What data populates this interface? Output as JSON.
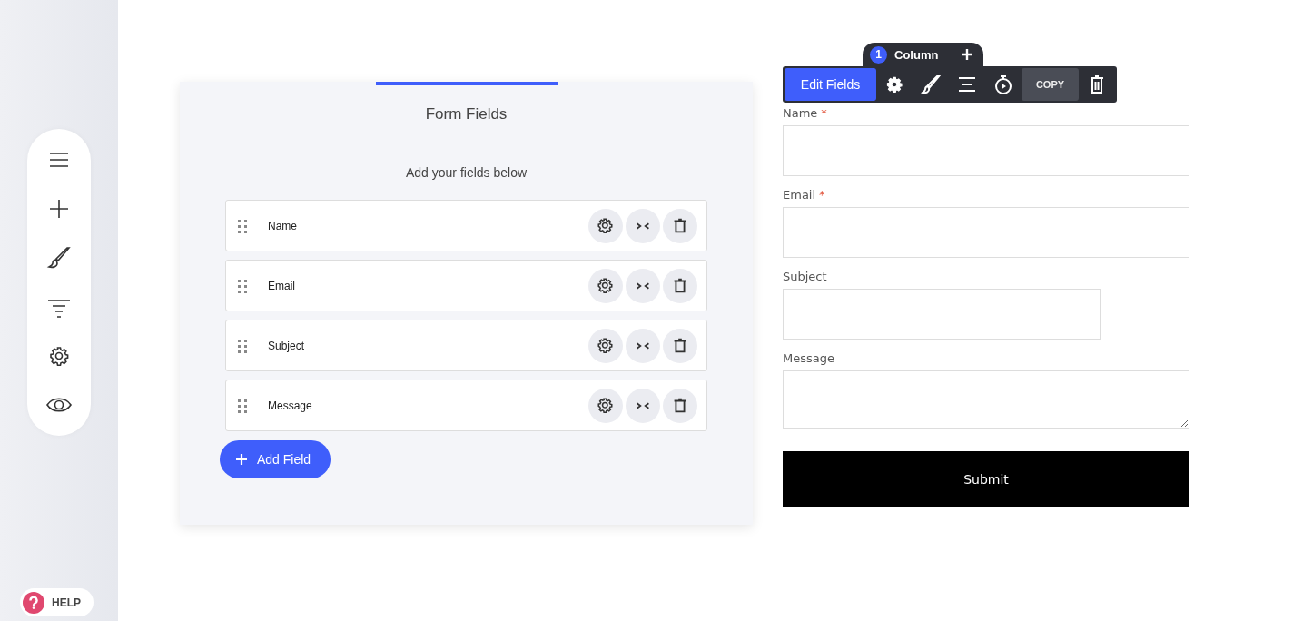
{
  "sidebar": {
    "tools": [
      {
        "kind": "menu"
      },
      {
        "kind": "add"
      },
      {
        "kind": "brush"
      },
      {
        "kind": "filter"
      },
      {
        "kind": "settings"
      },
      {
        "kind": "preview"
      }
    ],
    "help_button": "HELP"
  },
  "fields_panel": {
    "title": "Form Fields",
    "subtitle": "Add your fields below",
    "fields": [
      {
        "label": "Name"
      },
      {
        "label": "Email"
      },
      {
        "label": "Subject"
      },
      {
        "label": "Message"
      }
    ],
    "add_button": "Add Field"
  },
  "column_tab": {
    "number": "1",
    "label": "Column"
  },
  "toolbar": {
    "edit_button": "Edit Fields",
    "copy_button": "COPY"
  },
  "required_marker": "*",
  "form": {
    "fields": [
      {
        "label": "Name",
        "required": true,
        "kind": "wide"
      },
      {
        "label": "Email",
        "required": true,
        "kind": "wide"
      },
      {
        "label": "Subject",
        "required": false,
        "kind": "narrow"
      },
      {
        "label": "Message",
        "required": false,
        "kind": "textarea"
      }
    ],
    "submit_button": "Submit"
  }
}
